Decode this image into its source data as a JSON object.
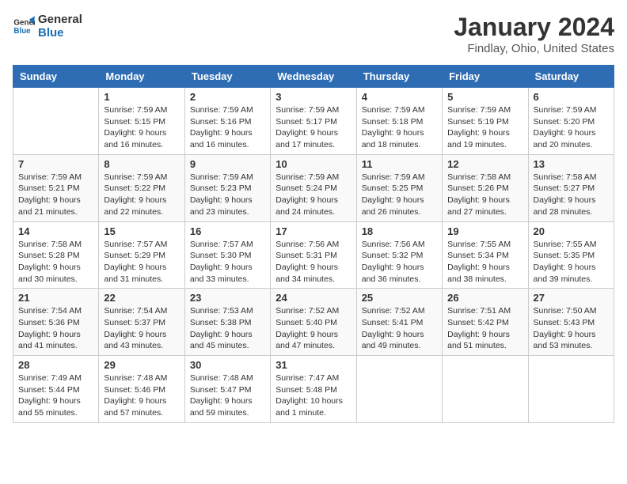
{
  "logo": {
    "line1": "General",
    "line2": "Blue"
  },
  "title": "January 2024",
  "subtitle": "Findlay, Ohio, United States",
  "days_header": [
    "Sunday",
    "Monday",
    "Tuesday",
    "Wednesday",
    "Thursday",
    "Friday",
    "Saturday"
  ],
  "weeks": [
    [
      {
        "num": "",
        "info": ""
      },
      {
        "num": "1",
        "info": "Sunrise: 7:59 AM\nSunset: 5:15 PM\nDaylight: 9 hours\nand 16 minutes."
      },
      {
        "num": "2",
        "info": "Sunrise: 7:59 AM\nSunset: 5:16 PM\nDaylight: 9 hours\nand 16 minutes."
      },
      {
        "num": "3",
        "info": "Sunrise: 7:59 AM\nSunset: 5:17 PM\nDaylight: 9 hours\nand 17 minutes."
      },
      {
        "num": "4",
        "info": "Sunrise: 7:59 AM\nSunset: 5:18 PM\nDaylight: 9 hours\nand 18 minutes."
      },
      {
        "num": "5",
        "info": "Sunrise: 7:59 AM\nSunset: 5:19 PM\nDaylight: 9 hours\nand 19 minutes."
      },
      {
        "num": "6",
        "info": "Sunrise: 7:59 AM\nSunset: 5:20 PM\nDaylight: 9 hours\nand 20 minutes."
      }
    ],
    [
      {
        "num": "7",
        "info": "Sunrise: 7:59 AM\nSunset: 5:21 PM\nDaylight: 9 hours\nand 21 minutes."
      },
      {
        "num": "8",
        "info": "Sunrise: 7:59 AM\nSunset: 5:22 PM\nDaylight: 9 hours\nand 22 minutes."
      },
      {
        "num": "9",
        "info": "Sunrise: 7:59 AM\nSunset: 5:23 PM\nDaylight: 9 hours\nand 23 minutes."
      },
      {
        "num": "10",
        "info": "Sunrise: 7:59 AM\nSunset: 5:24 PM\nDaylight: 9 hours\nand 24 minutes."
      },
      {
        "num": "11",
        "info": "Sunrise: 7:59 AM\nSunset: 5:25 PM\nDaylight: 9 hours\nand 26 minutes."
      },
      {
        "num": "12",
        "info": "Sunrise: 7:58 AM\nSunset: 5:26 PM\nDaylight: 9 hours\nand 27 minutes."
      },
      {
        "num": "13",
        "info": "Sunrise: 7:58 AM\nSunset: 5:27 PM\nDaylight: 9 hours\nand 28 minutes."
      }
    ],
    [
      {
        "num": "14",
        "info": "Sunrise: 7:58 AM\nSunset: 5:28 PM\nDaylight: 9 hours\nand 30 minutes."
      },
      {
        "num": "15",
        "info": "Sunrise: 7:57 AM\nSunset: 5:29 PM\nDaylight: 9 hours\nand 31 minutes."
      },
      {
        "num": "16",
        "info": "Sunrise: 7:57 AM\nSunset: 5:30 PM\nDaylight: 9 hours\nand 33 minutes."
      },
      {
        "num": "17",
        "info": "Sunrise: 7:56 AM\nSunset: 5:31 PM\nDaylight: 9 hours\nand 34 minutes."
      },
      {
        "num": "18",
        "info": "Sunrise: 7:56 AM\nSunset: 5:32 PM\nDaylight: 9 hours\nand 36 minutes."
      },
      {
        "num": "19",
        "info": "Sunrise: 7:55 AM\nSunset: 5:34 PM\nDaylight: 9 hours\nand 38 minutes."
      },
      {
        "num": "20",
        "info": "Sunrise: 7:55 AM\nSunset: 5:35 PM\nDaylight: 9 hours\nand 39 minutes."
      }
    ],
    [
      {
        "num": "21",
        "info": "Sunrise: 7:54 AM\nSunset: 5:36 PM\nDaylight: 9 hours\nand 41 minutes."
      },
      {
        "num": "22",
        "info": "Sunrise: 7:54 AM\nSunset: 5:37 PM\nDaylight: 9 hours\nand 43 minutes."
      },
      {
        "num": "23",
        "info": "Sunrise: 7:53 AM\nSunset: 5:38 PM\nDaylight: 9 hours\nand 45 minutes."
      },
      {
        "num": "24",
        "info": "Sunrise: 7:52 AM\nSunset: 5:40 PM\nDaylight: 9 hours\nand 47 minutes."
      },
      {
        "num": "25",
        "info": "Sunrise: 7:52 AM\nSunset: 5:41 PM\nDaylight: 9 hours\nand 49 minutes."
      },
      {
        "num": "26",
        "info": "Sunrise: 7:51 AM\nSunset: 5:42 PM\nDaylight: 9 hours\nand 51 minutes."
      },
      {
        "num": "27",
        "info": "Sunrise: 7:50 AM\nSunset: 5:43 PM\nDaylight: 9 hours\nand 53 minutes."
      }
    ],
    [
      {
        "num": "28",
        "info": "Sunrise: 7:49 AM\nSunset: 5:44 PM\nDaylight: 9 hours\nand 55 minutes."
      },
      {
        "num": "29",
        "info": "Sunrise: 7:48 AM\nSunset: 5:46 PM\nDaylight: 9 hours\nand 57 minutes."
      },
      {
        "num": "30",
        "info": "Sunrise: 7:48 AM\nSunset: 5:47 PM\nDaylight: 9 hours\nand 59 minutes."
      },
      {
        "num": "31",
        "info": "Sunrise: 7:47 AM\nSunset: 5:48 PM\nDaylight: 10 hours\nand 1 minute."
      },
      {
        "num": "",
        "info": ""
      },
      {
        "num": "",
        "info": ""
      },
      {
        "num": "",
        "info": ""
      }
    ]
  ]
}
